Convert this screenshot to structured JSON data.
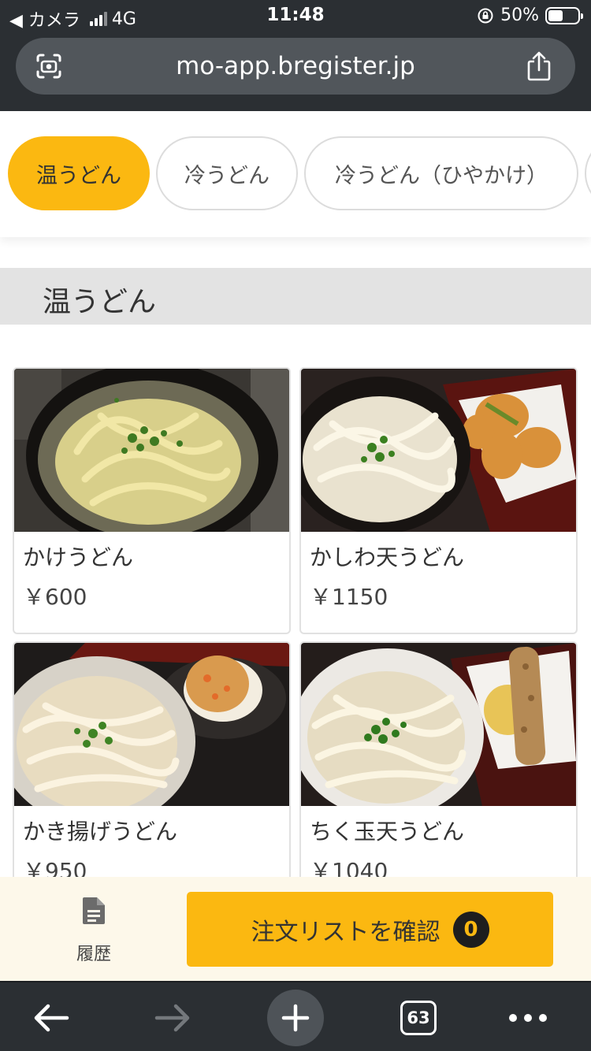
{
  "status_bar": {
    "back_app": "◀ カメラ",
    "network": "4G",
    "time": "11:48",
    "battery": "50%",
    "battery_level": 0.5
  },
  "browser": {
    "url": "mo-app.bregister.jp",
    "tabs_count": "63"
  },
  "category_tabs": [
    {
      "label": "温うどん",
      "active": true
    },
    {
      "label": "冷うどん",
      "active": false
    },
    {
      "label": "冷うどん（ひやかけ）",
      "active": false
    }
  ],
  "section": {
    "title": "温うどん"
  },
  "menu_items": [
    {
      "name": "かけうどん",
      "price": "￥600"
    },
    {
      "name": "かしわ天うどん",
      "price": "￥1150"
    },
    {
      "name": "かき揚げうどん",
      "price": "￥950"
    },
    {
      "name": "ちく玉天うどん",
      "price": "￥1040"
    }
  ],
  "order_bar": {
    "history_label": "履歴",
    "confirm_label": "注文リストを確認",
    "count": "0"
  },
  "colors": {
    "accent": "#fbb811",
    "chrome": "#2b2f33",
    "section_bg": "#e3e3e3",
    "order_bar_bg": "#fdf8ea"
  },
  "icons": {
    "camera": "camera-scan-icon",
    "share": "share-icon",
    "history": "document-icon",
    "back": "arrow-left-icon",
    "forward": "arrow-right-icon",
    "new_tab": "plus-icon",
    "more": "more-dots-icon"
  }
}
